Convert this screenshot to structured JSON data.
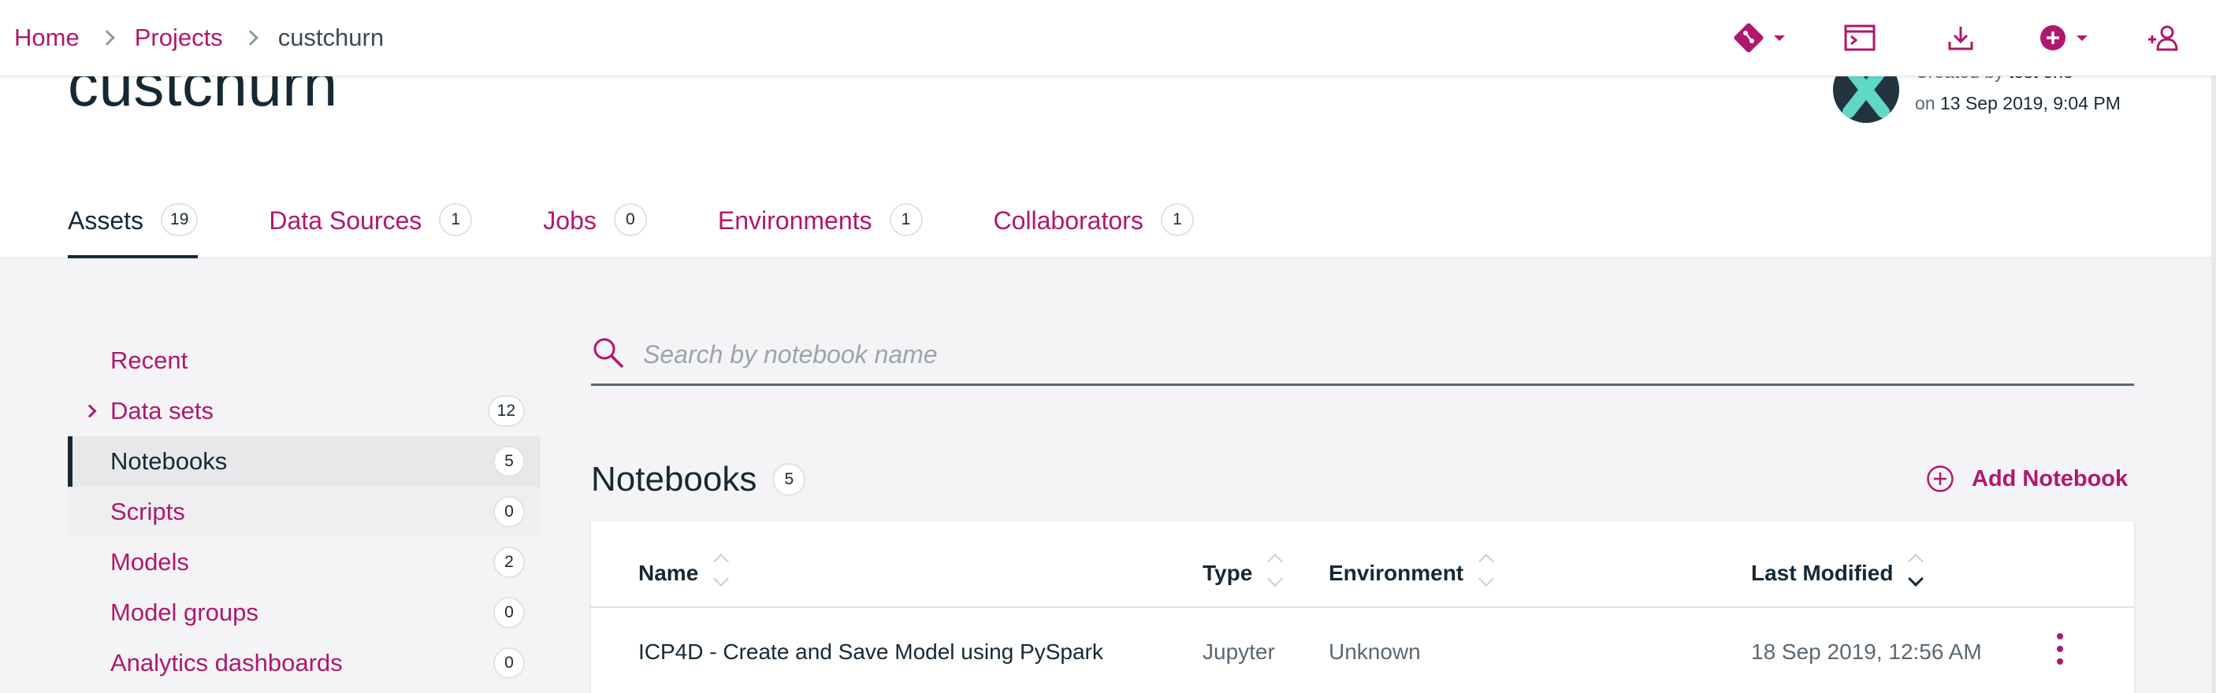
{
  "breadcrumb": {
    "home": "Home",
    "projects": "Projects",
    "current": "custchurn"
  },
  "header_icons": [
    "git-icon",
    "terminal-icon",
    "download-icon",
    "add-circle-icon",
    "add-user-icon"
  ],
  "project": {
    "title": "custchurn",
    "created_by_label": "Created by",
    "created_by": "test one",
    "on_label": "on",
    "created_on": "13 Sep 2019, 9:04 PM"
  },
  "tabs": [
    {
      "label": "Assets",
      "count": "19",
      "active": true
    },
    {
      "label": "Data Sources",
      "count": "1"
    },
    {
      "label": "Jobs",
      "count": "0"
    },
    {
      "label": "Environments",
      "count": "1"
    },
    {
      "label": "Collaborators",
      "count": "1"
    }
  ],
  "sidenav": {
    "items": [
      {
        "label": "Recent",
        "count": null
      },
      {
        "label": "Data sets",
        "count": "12",
        "expandable": true
      },
      {
        "label": "Notebooks",
        "count": "5",
        "active": true
      },
      {
        "label": "Scripts",
        "count": "0"
      },
      {
        "label": "Models",
        "count": "2"
      },
      {
        "label": "Model groups",
        "count": "0"
      },
      {
        "label": "Analytics dashboards",
        "count": "0"
      }
    ]
  },
  "search": {
    "placeholder": "Search by notebook name",
    "value": ""
  },
  "notebooks": {
    "title": "Notebooks",
    "count": "5",
    "add_label": "Add Notebook",
    "columns": [
      "Name",
      "Type",
      "Environment",
      "Last Modified"
    ],
    "sorted_column": "Last Modified",
    "rows": [
      {
        "name": "ICP4D - Create and Save Model using PySpark",
        "type": "Jupyter",
        "environment": "Unknown",
        "last_modified": "18 Sep 2019, 12:56 AM"
      }
    ]
  },
  "colors": {
    "accent": "#b0176e",
    "text_primary": "#152935",
    "text_muted": "#5a6872",
    "background": "#f4f4f6"
  }
}
